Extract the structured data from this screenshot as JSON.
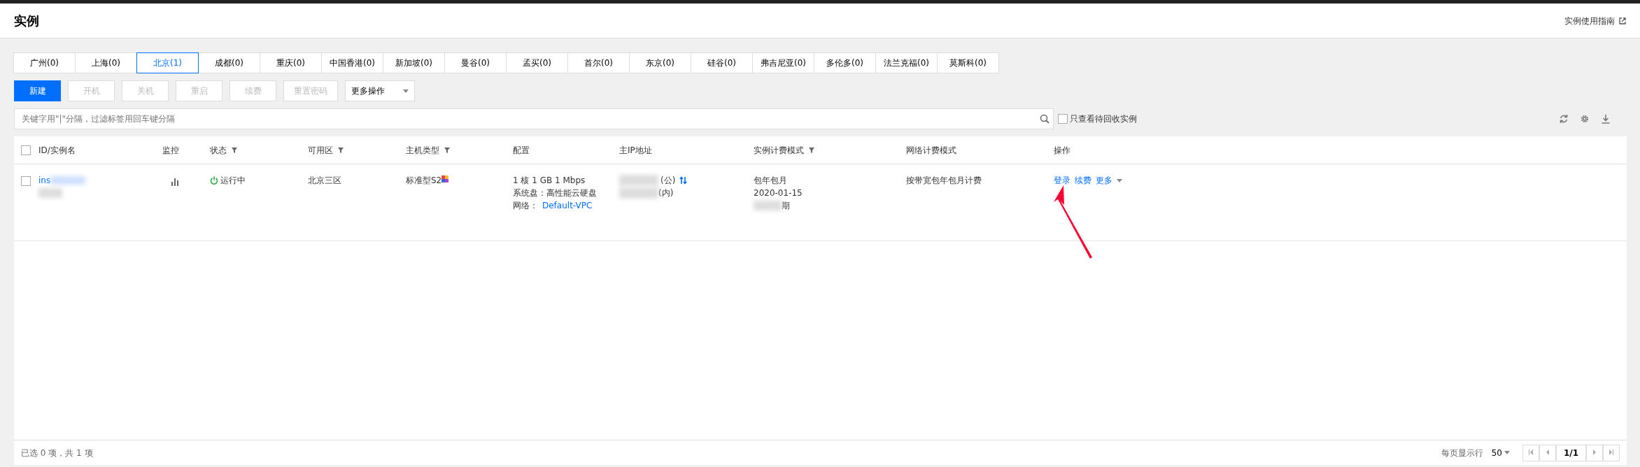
{
  "header": {
    "title": "实例",
    "guide_link": "实例使用指南"
  },
  "regions": [
    {
      "label": "广州(0)",
      "selected": false
    },
    {
      "label": "上海(0)",
      "selected": false
    },
    {
      "label": "北京(1)",
      "selected": true
    },
    {
      "label": "成都(0)",
      "selected": false
    },
    {
      "label": "重庆(0)",
      "selected": false
    },
    {
      "label": "中国香港(0)",
      "selected": false
    },
    {
      "label": "新加坡(0)",
      "selected": false
    },
    {
      "label": "曼谷(0)",
      "selected": false
    },
    {
      "label": "孟买(0)",
      "selected": false
    },
    {
      "label": "首尔(0)",
      "selected": false
    },
    {
      "label": "东京(0)",
      "selected": false
    },
    {
      "label": "硅谷(0)",
      "selected": false
    },
    {
      "label": "弗吉尼亚(0)",
      "selected": false
    },
    {
      "label": "多伦多(0)",
      "selected": false
    },
    {
      "label": "法兰克福(0)",
      "selected": false
    },
    {
      "label": "莫斯科(0)",
      "selected": false
    }
  ],
  "toolbar": {
    "buttons": [
      {
        "label": "新建",
        "kind": "primary",
        "disabled": false
      },
      {
        "label": "开机",
        "kind": "default",
        "disabled": true
      },
      {
        "label": "关机",
        "kind": "default",
        "disabled": true
      },
      {
        "label": "重启",
        "kind": "default",
        "disabled": true
      },
      {
        "label": "续费",
        "kind": "default",
        "disabled": true
      },
      {
        "label": "重置密码",
        "kind": "default",
        "disabled": true
      }
    ],
    "more_dropdown": "更多操作"
  },
  "search": {
    "placeholder": "关键字用\"|\"分隔，过滤标签用回车键分隔"
  },
  "recycle_filter": {
    "label": "只查看待回收实例",
    "checked": false
  },
  "table": {
    "select_all_checked": false,
    "columns": [
      {
        "label": "ID/实例名",
        "filter": false
      },
      {
        "label": "监控",
        "filter": false
      },
      {
        "label": "状态",
        "filter": true
      },
      {
        "label": "可用区",
        "filter": true
      },
      {
        "label": "主机类型",
        "filter": true
      },
      {
        "label": "配置",
        "filter": false
      },
      {
        "label": "主IP地址",
        "filter": false
      },
      {
        "label": "实例计费模式",
        "filter": true
      },
      {
        "label": "网络计费模式",
        "filter": false
      },
      {
        "label": "操作",
        "filter": false
      }
    ],
    "rows": [
      {
        "checked": false,
        "id": "ins",
        "status": "运行中",
        "zone": "北京三区",
        "type": "标准型S2",
        "config": [
          "1 核 1 GB 1 Mbps",
          "系统盘：高性能云硬盘"
        ],
        "network_label": "网络：",
        "network": "Default-VPC",
        "ip_public": "(公)",
        "ip_private": "(内)",
        "billing": [
          "包年包月",
          "2020-01-15"
        ],
        "billing_expiry": "期",
        "net_billing": "按带宽包年包月计费",
        "actions": [
          "登录",
          "续费",
          "更多"
        ]
      }
    ]
  },
  "footer": {
    "selection": "已选 0 项，共 1 项",
    "page_size_label": "每页显示行",
    "page_size": "50",
    "page": "1/1"
  }
}
